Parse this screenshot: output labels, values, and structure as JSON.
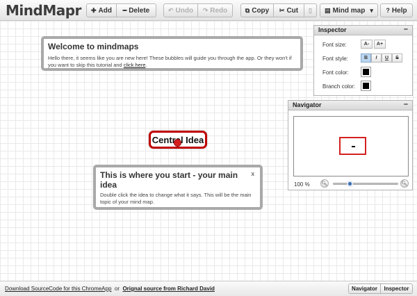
{
  "app": {
    "title": "MindMapr"
  },
  "toolbar": {
    "add": "Add",
    "delete": "Delete",
    "undo": "Undo",
    "redo": "Redo",
    "copy": "Copy",
    "cut": "Cut",
    "mode": "Mind map",
    "help": "Help"
  },
  "welcome": {
    "title": "Welcome to mindmaps",
    "text": "Hello there, it seems like you are new here! These bubbles will guide you through the app. Or they won't if you want to skip this tutorial and",
    "link": "click here",
    "end": "."
  },
  "tip": {
    "title": "This is where you start - your main idea",
    "close": "x",
    "text": "Double click the idea to change what it says. This will be the main topic of your mind map."
  },
  "central_idea": "Central Idea",
  "inspector": {
    "title": "Inspector",
    "minimize": "–",
    "font_size": "Font size:",
    "font_style": "Font style:",
    "font_color": "Font color:",
    "branch_color": "Branch color:",
    "size_down": "A-",
    "size_up": "A+",
    "bold": "B",
    "italic": "I",
    "underline": "U",
    "strike": "S"
  },
  "navigator": {
    "title": "Navigator",
    "minimize": "–",
    "zoom": "100 %",
    "zoom_level": 0.25
  },
  "status": {
    "download": "Download SourceCode for this ChromeApp",
    "or": "or",
    "original": "Orignal source from Richard David",
    "navigator_btn": "Navigator",
    "inspector_btn": "Inspector"
  },
  "colors": {
    "accent": "#c00000",
    "font_color": "#000000",
    "branch_color": "#000000",
    "slider": "#3b6db1"
  }
}
